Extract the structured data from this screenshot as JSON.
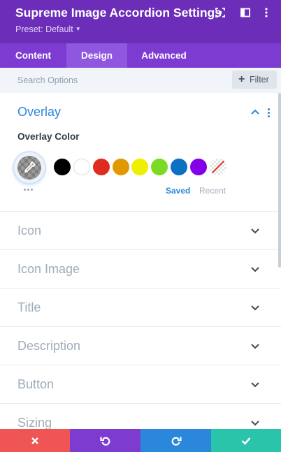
{
  "header": {
    "title": "Supreme Image Accordion Settings",
    "preset_label": "Preset: Default",
    "icons": [
      "expand-icon",
      "split-view-icon",
      "more-vertical-icon"
    ]
  },
  "tabs": [
    {
      "label": "Content",
      "active": false
    },
    {
      "label": "Design",
      "active": true
    },
    {
      "label": "Advanced",
      "active": false
    }
  ],
  "search": {
    "placeholder": "Search Options",
    "filter_label": "Filter"
  },
  "overlay": {
    "title": "Overlay",
    "expanded": true,
    "color_label": "Overlay Color",
    "swatches": [
      {
        "name": "black",
        "color": "#000000"
      },
      {
        "name": "white",
        "color": "#ffffff"
      },
      {
        "name": "red",
        "color": "#e02b20"
      },
      {
        "name": "orange",
        "color": "#e09900"
      },
      {
        "name": "yellow",
        "color": "#edf000"
      },
      {
        "name": "green",
        "color": "#7cda24"
      },
      {
        "name": "blue",
        "color": "#0c71c3"
      },
      {
        "name": "purple",
        "color": "#8300e9"
      },
      {
        "name": "transparent",
        "color": "none"
      }
    ],
    "saved_label": "Saved",
    "recent_label": "Recent"
  },
  "sections": [
    {
      "label": "Icon"
    },
    {
      "label": "Icon Image"
    },
    {
      "label": "Title"
    },
    {
      "label": "Description"
    },
    {
      "label": "Button"
    },
    {
      "label": "Sizing"
    }
  ],
  "actions": [
    {
      "name": "cancel",
      "color": "#ef5555"
    },
    {
      "name": "undo",
      "color": "#7e3bd0"
    },
    {
      "name": "redo",
      "color": "#2b87da"
    },
    {
      "name": "save",
      "color": "#29c4a9"
    }
  ],
  "colors": {
    "header_bg": "#6c2eb9",
    "tabs_bg": "#7d3bd1",
    "active_tab_bg": "#8f56e0",
    "accent_blue": "#2b87da"
  }
}
